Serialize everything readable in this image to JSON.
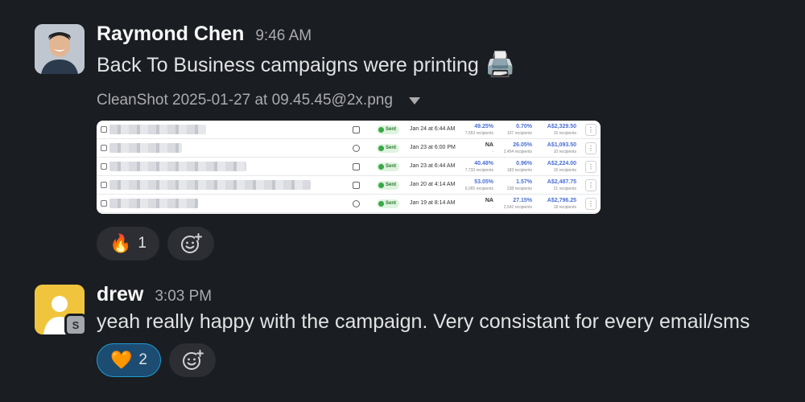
{
  "messages": [
    {
      "sender": "Raymond Chen",
      "time": "9:46 AM",
      "text": "Back To Business campaigns were printing",
      "text_emoji": "🖨️",
      "attachment": {
        "filename": "CleanShot 2025-01-27 at 09.45.45@2x.png",
        "rows": [
          {
            "channel": "email",
            "status": "Sent",
            "date": "Jan 24 at 6:44 AM",
            "open_rate": "49.25%",
            "open_sub": "7,553 recipients",
            "click_rate": "0.70%",
            "click_sub": "107 recipients",
            "revenue": "A$2,329.50",
            "revenue_sub": "16 recipients"
          },
          {
            "channel": "sms",
            "status": "Sent",
            "date": "Jan 23 at 6:00 PM",
            "open_rate": "NA",
            "open_sub": "-",
            "click_rate": "26.05%",
            "click_sub": "2,454 recipients",
            "revenue": "A$1,093.50",
            "revenue_sub": "10 recipients"
          },
          {
            "channel": "email",
            "status": "Sent",
            "date": "Jan 23 at 6:44 AM",
            "open_rate": "40.48%",
            "open_sub": "7,733 recipients",
            "click_rate": "0.96%",
            "click_sub": "183 recipients",
            "revenue": "A$2,224.00",
            "revenue_sub": "16 recipients"
          },
          {
            "channel": "email",
            "status": "Sent",
            "date": "Jan 20 at 4:14 AM",
            "open_rate": "53.05%",
            "open_sub": "6,065 recipients",
            "click_rate": "1.57%",
            "click_sub": "238 recipients",
            "revenue": "A$2,487.75",
            "revenue_sub": "21 recipients"
          },
          {
            "channel": "sms",
            "status": "Sent",
            "date": "Jan 19 at 8:14 AM",
            "open_rate": "NA",
            "open_sub": "-",
            "click_rate": "27.15%",
            "click_sub": "2,542 recipients",
            "revenue": "A$2,796.25",
            "revenue_sub": "18 recipients"
          }
        ]
      },
      "reactions": [
        {
          "emoji": "fire-person-emoji",
          "glyph": "🔥",
          "count": "1"
        }
      ]
    },
    {
      "sender": "drew",
      "time": "3:03 PM",
      "badge": "S",
      "text": "yeah really happy with the campaign. Very consistant for every email/sms",
      "reactions": [
        {
          "emoji": "orange-heart-emoji",
          "glyph": "🧡",
          "count": "2"
        }
      ]
    }
  ],
  "add_reaction_icon": "add-reaction-icon",
  "colors": {
    "background": "#1a1d21",
    "active_reaction": "#1d4c72",
    "active_reaction_border": "#1d9bd1"
  }
}
